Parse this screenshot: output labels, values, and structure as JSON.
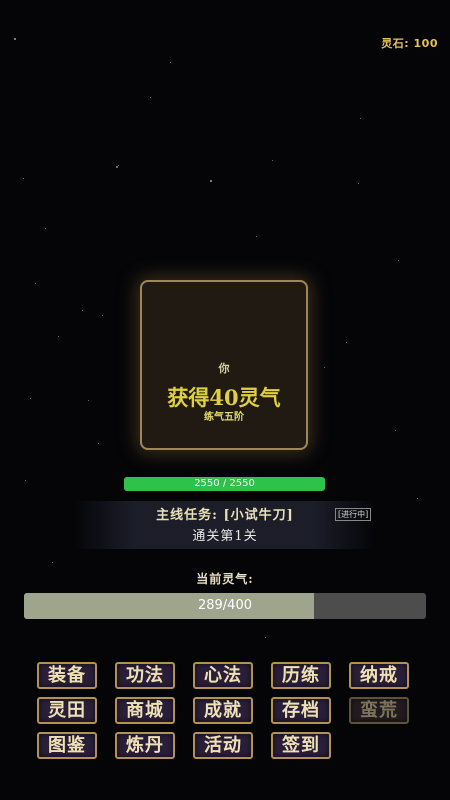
{
  "header": {
    "spirit_stones": "灵石: 100"
  },
  "card": {
    "who": "你",
    "gain_text": "获得40灵气",
    "realm": "练气五阶"
  },
  "hp": {
    "text": "2550 / 2550",
    "fraction": 1.0,
    "color": "#2ec24a"
  },
  "quest": {
    "title": "主线任务: [小试牛刀]",
    "status": "[进行中]",
    "goal": "通关第1关"
  },
  "qi": {
    "label": "当前灵气:",
    "text": "289/400",
    "fraction": 0.7225
  },
  "menu": {
    "items": [
      {
        "label": "装备",
        "enabled": true
      },
      {
        "label": "功法",
        "enabled": true
      },
      {
        "label": "心法",
        "enabled": true
      },
      {
        "label": "历练",
        "enabled": true
      },
      {
        "label": "纳戒",
        "enabled": true
      },
      {
        "label": "灵田",
        "enabled": true
      },
      {
        "label": "商城",
        "enabled": true
      },
      {
        "label": "成就",
        "enabled": true
      },
      {
        "label": "存档",
        "enabled": true
      },
      {
        "label": "蛮荒",
        "enabled": false
      },
      {
        "label": "图鉴",
        "enabled": true
      },
      {
        "label": "炼丹",
        "enabled": true
      },
      {
        "label": "活动",
        "enabled": true
      },
      {
        "label": "签到",
        "enabled": true
      }
    ]
  }
}
